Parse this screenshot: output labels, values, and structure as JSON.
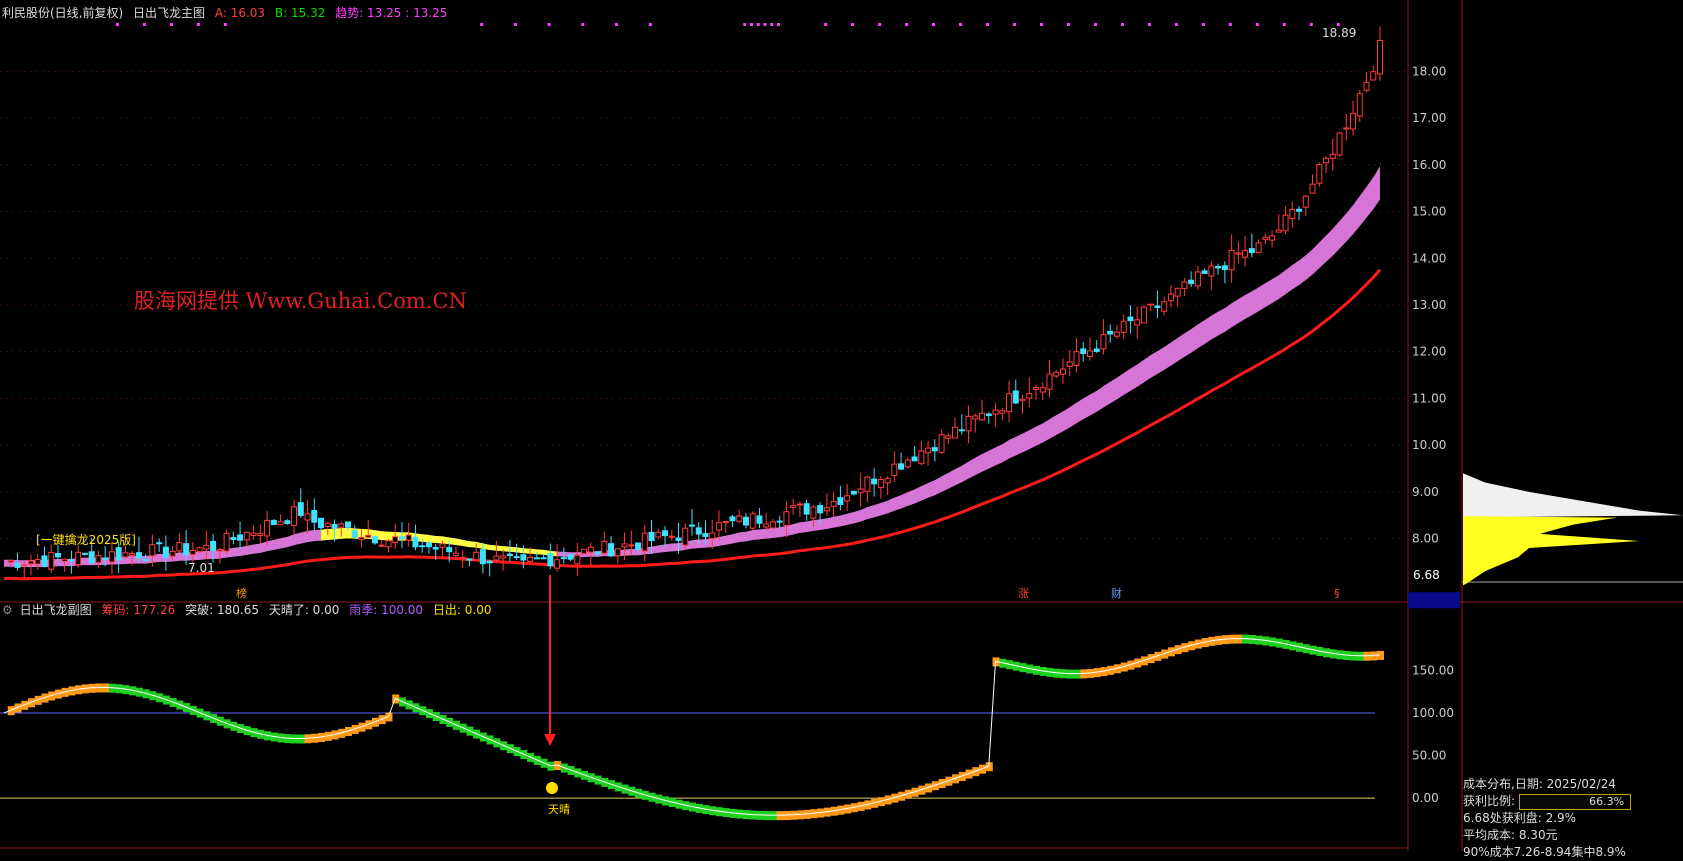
{
  "header": {
    "stock_label": "利民股份(日线,前复权)",
    "indicator_name": "日出飞龙主图",
    "a_label": "A: 16.03",
    "b_label": "B: 15.32",
    "trend_label": "趋势: 13.25 : 13.25",
    "a_color": "#ff4040",
    "b_color": "#00e000",
    "trend_color": "#ff40ff"
  },
  "sub_header": {
    "indicator_name": "日出飞龙副图",
    "chip_label": "筹码: 177.26",
    "breakout_label": "突破: 180.65",
    "sunny_label": "天晴了: 0.00",
    "rain_label": "雨季: 100.00",
    "sunrise_label": "日出: 0.00"
  },
  "watermark": "股海网提供 Www.Guhai.Com.CN",
  "annotations": {
    "ribbon_label": "[一键擒龙2025版]",
    "low_price": "7.01",
    "high_price": "18.89",
    "marker_bang": "榜",
    "marker_zhang": "涨",
    "marker_cai": "财",
    "marker_s": "§",
    "sub_marker": "天晴"
  },
  "price_axis": {
    "current_tag": "6.68"
  },
  "cost_panel": {
    "title": "成本分布,日期: 2025/02/24",
    "profit_ratio_label": "获利比例:",
    "profit_ratio_value": "66.3%",
    "profit_ratio": 0.663,
    "profit_at_price": "6.68处获利盘: 2.9%",
    "avg_cost": "平均成本: 8.30元",
    "concentration": "90%成本7.26-8.94集中8.9%"
  },
  "chart_data": [
    {
      "type": "candlestick",
      "name": "main",
      "ylim": [
        6.9,
        19.1
      ],
      "yticks": [
        8.0,
        9.0,
        10.0,
        11.0,
        12.0,
        13.0,
        14.0,
        15.0,
        16.0,
        17.0,
        18.0
      ],
      "annotations": {
        "high": 18.89,
        "low": 7.01,
        "current": 6.68
      }
    },
    {
      "type": "line",
      "name": "sub",
      "ylim": [
        -55,
        215
      ],
      "yticks": [
        0.0,
        50.0,
        100.0,
        150.0
      ],
      "series": [
        {
          "name": "筹码",
          "last_value": 177.26
        },
        {
          "name": "雨季",
          "value": 100.0
        },
        {
          "name": "日出",
          "value": 0.0
        }
      ]
    }
  ]
}
